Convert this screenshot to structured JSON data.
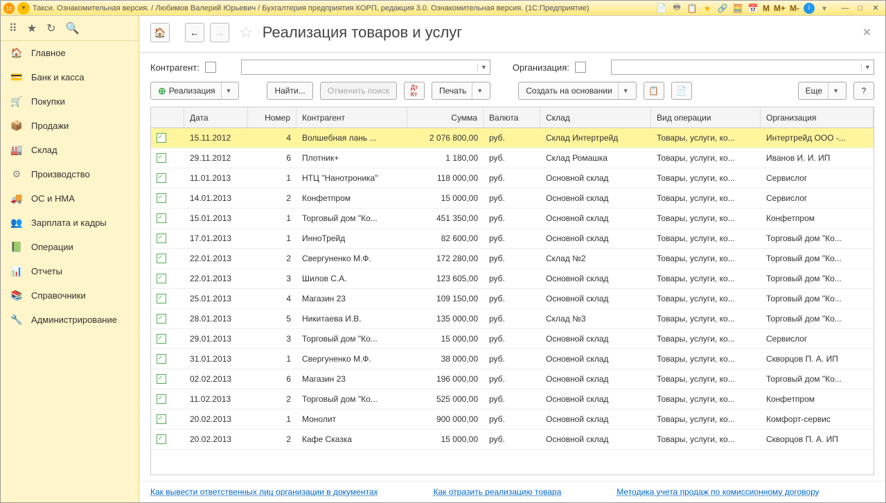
{
  "titlebar": {
    "title": "Такси. Ознакомительная версия. / Любимов Валерий Юрьевич / Бухгалтерия предприятия КОРП, редакция 3.0. Ознакомительная версия.  (1С:Предприятие)",
    "m1": "M",
    "m2": "M+",
    "m3": "M-"
  },
  "sidebar": {
    "items": [
      {
        "icon": "🏠",
        "label": "Главное",
        "color": "#d4a829"
      },
      {
        "icon": "💳",
        "label": "Банк и касса",
        "color": "#e86868"
      },
      {
        "icon": "🛒",
        "label": "Покупки",
        "color": "#5aa7d6"
      },
      {
        "icon": "📦",
        "label": "Продажи",
        "color": "#e8a03c"
      },
      {
        "icon": "🏭",
        "label": "Склад",
        "color": "#b88a4a"
      },
      {
        "icon": "⚙",
        "label": "Производство",
        "color": "#888"
      },
      {
        "icon": "🚚",
        "label": "ОС и НМА",
        "color": "#d44"
      },
      {
        "icon": "👥",
        "label": "Зарплата и кадры",
        "color": "#5aa7d6"
      },
      {
        "icon": "📗",
        "label": "Операции",
        "color": "#4caf50"
      },
      {
        "icon": "📊",
        "label": "Отчеты",
        "color": "#4a7aa8"
      },
      {
        "icon": "📚",
        "label": "Справочники",
        "color": "#c98838"
      },
      {
        "icon": "🔧",
        "label": "Администрирование",
        "color": "#888"
      }
    ]
  },
  "header": {
    "title": "Реализация товаров и услуг"
  },
  "filters": {
    "contragent_label": "Контрагент:",
    "org_label": "Организация:"
  },
  "toolbar": {
    "realizatsiya": "Реализация",
    "find": "Найти...",
    "cancel_search": "Отменить поиск",
    "print": "Печать",
    "create_based": "Создать на основании",
    "more": "Еще",
    "help": "?"
  },
  "table": {
    "headers": {
      "date": "Дата",
      "number": "Номер",
      "contragent": "Контрагент",
      "sum": "Сумма",
      "currency": "Валюта",
      "sklad": "Склад",
      "operation": "Вид операции",
      "org": "Организация"
    },
    "rows": [
      {
        "date": "15.11.2012",
        "num": "4",
        "contr": "Волшебная лань ...",
        "sum": "2 076 800,00",
        "cur": "руб.",
        "skl": "Склад Интертрейд",
        "op": "Товары, услуги, ко...",
        "org": "Интертрейд ООО -...",
        "selected": true
      },
      {
        "date": "29.11.2012",
        "num": "6",
        "contr": "Плотник+",
        "sum": "1 180,00",
        "cur": "руб.",
        "skl": "Склад Ромашка",
        "op": "Товары, услуги, ко...",
        "org": "Иванов И. И. ИП"
      },
      {
        "date": "11.01.2013",
        "num": "1",
        "contr": "НТЦ \"Нанотроника\"",
        "sum": "118 000,00",
        "cur": "руб.",
        "skl": "Основной склад",
        "op": "Товары, услуги, ко...",
        "org": "Сервислог"
      },
      {
        "date": "14.01.2013",
        "num": "2",
        "contr": "Конфетпром",
        "sum": "15 000,00",
        "cur": "руб.",
        "skl": "Основной склад",
        "op": "Товары, услуги, ко...",
        "org": "Сервислог"
      },
      {
        "date": "15.01.2013",
        "num": "1",
        "contr": "Торговый дом \"Ко...",
        "sum": "451 350,00",
        "cur": "руб.",
        "skl": "Основной склад",
        "op": "Товары, услуги, ко...",
        "org": "Конфетпром"
      },
      {
        "date": "17.01.2013",
        "num": "1",
        "contr": "ИнноТрейд",
        "sum": "82 600,00",
        "cur": "руб.",
        "skl": "Основной склад",
        "op": "Товары, услуги, ко...",
        "org": "Торговый дом \"Ко..."
      },
      {
        "date": "22.01.2013",
        "num": "2",
        "contr": "Свергуненко М.Ф.",
        "sum": "172 280,00",
        "cur": "руб.",
        "skl": "Склад №2",
        "op": "Товары, услуги, ко...",
        "org": "Торговый дом \"Ко..."
      },
      {
        "date": "22.01.2013",
        "num": "3",
        "contr": "Шилов С.А.",
        "sum": "123 605,00",
        "cur": "руб.",
        "skl": "Основной склад",
        "op": "Товары, услуги, ко...",
        "org": "Торговый дом \"Ко..."
      },
      {
        "date": "25.01.2013",
        "num": "4",
        "contr": "Магазин 23",
        "sum": "109 150,00",
        "cur": "руб.",
        "skl": "Основной склад",
        "op": "Товары, услуги, ко...",
        "org": "Торговый дом \"Ко..."
      },
      {
        "date": "28.01.2013",
        "num": "5",
        "contr": "Никитаева И.В.",
        "sum": "135 000,00",
        "cur": "руб.",
        "skl": "Склад №3",
        "op": "Товары, услуги, ко...",
        "org": "Торговый дом \"Ко..."
      },
      {
        "date": "29.01.2013",
        "num": "3",
        "contr": "Торговый дом \"Ко...",
        "sum": "15 000,00",
        "cur": "руб.",
        "skl": "Основной склад",
        "op": "Товары, услуги, ко...",
        "org": "Сервислог"
      },
      {
        "date": "31.01.2013",
        "num": "1",
        "contr": "Свергуненко М.Ф.",
        "sum": "38 000,00",
        "cur": "руб.",
        "skl": "Основной склад",
        "op": "Товары, услуги, ко...",
        "org": "Скворцов П. А. ИП"
      },
      {
        "date": "02.02.2013",
        "num": "6",
        "contr": "Магазин 23",
        "sum": "196 000,00",
        "cur": "руб.",
        "skl": "Основной склад",
        "op": "Товары, услуги, ко...",
        "org": "Торговый дом \"Ко..."
      },
      {
        "date": "11.02.2013",
        "num": "2",
        "contr": "Торговый дом \"Ко...",
        "sum": "525 000,00",
        "cur": "руб.",
        "skl": "Основной склад",
        "op": "Товары, услуги, ко...",
        "org": "Конфетпром"
      },
      {
        "date": "20.02.2013",
        "num": "1",
        "contr": "Монолит",
        "sum": "900 000,00",
        "cur": "руб.",
        "skl": "Основной склад",
        "op": "Товары, услуги, ко...",
        "org": "Комфорт-сервис"
      },
      {
        "date": "20.02.2013",
        "num": "2",
        "contr": "Кафе Сказка",
        "sum": "15 000,00",
        "cur": "руб.",
        "skl": "Основной склад",
        "op": "Товары, услуги, ко...",
        "org": "Скворцов П. А. ИП"
      }
    ]
  },
  "footer": {
    "link1": "Как вывести ответственных лиц организации в документах",
    "link2": "Как отразить реализацию товара",
    "link3": "Методика учета продаж по комиссионному договору"
  }
}
